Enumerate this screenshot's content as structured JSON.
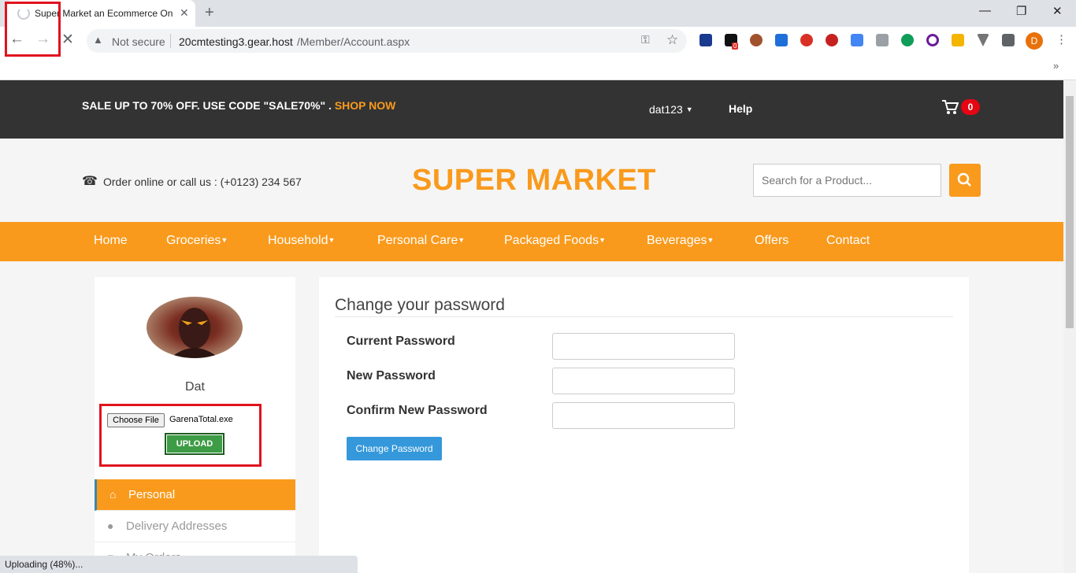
{
  "browser": {
    "tab_title": "Super Market an Ecommerce On",
    "tab_close": "✕",
    "new_tab": "+",
    "window_controls": [
      "—",
      "❐",
      "✕"
    ],
    "not_secure": "Not secure",
    "url_host": "20cmtesting3.gear.host",
    "url_path": "/Member/Account.aspx",
    "extension_badge": "0",
    "profile_initial": "D",
    "chevrons": "»",
    "status": "Uploading (48%)..."
  },
  "topbar": {
    "promo": "SALE UP TO 70% OFF. USE CODE \"SALE70%\" . ",
    "shop_now": "SHOP NOW",
    "username": "dat123",
    "help": "Help",
    "cart_count": "0"
  },
  "header": {
    "phone_text": "Order online or call us : (+0123) 234 567",
    "brand": "SUPER MARKET",
    "search_placeholder": "Search for a Product..."
  },
  "nav": {
    "items": [
      {
        "label": "Home"
      },
      {
        "label": "Groceries",
        "dropdown": true
      },
      {
        "label": "Household",
        "dropdown": true
      },
      {
        "label": "Personal Care",
        "dropdown": true
      },
      {
        "label": "Packaged Foods",
        "dropdown": true
      },
      {
        "label": "Beverages",
        "dropdown": true
      },
      {
        "label": "Offers"
      },
      {
        "label": "Contact"
      }
    ]
  },
  "sidebar": {
    "name": "Dat",
    "choose_file": "Choose File",
    "file_name": "GarenaTotal.exe",
    "upload": "UPLOAD",
    "items": [
      {
        "label": "Personal",
        "icon": "home-icon"
      },
      {
        "label": "Delivery Addresses",
        "icon": "user-icon"
      },
      {
        "label": "My Orders",
        "icon": "list-icon"
      }
    ]
  },
  "form": {
    "title": "Change your password",
    "current_password": "Current Password",
    "new_password": "New Password",
    "confirm_password": "Confirm New Password",
    "submit": "Change Password"
  },
  "colors": {
    "accent": "#f99a1c",
    "topbar": "#333333",
    "button_blue": "#3498db",
    "upload_green": "#3d9c45",
    "highlight_red": "#e0131e"
  }
}
